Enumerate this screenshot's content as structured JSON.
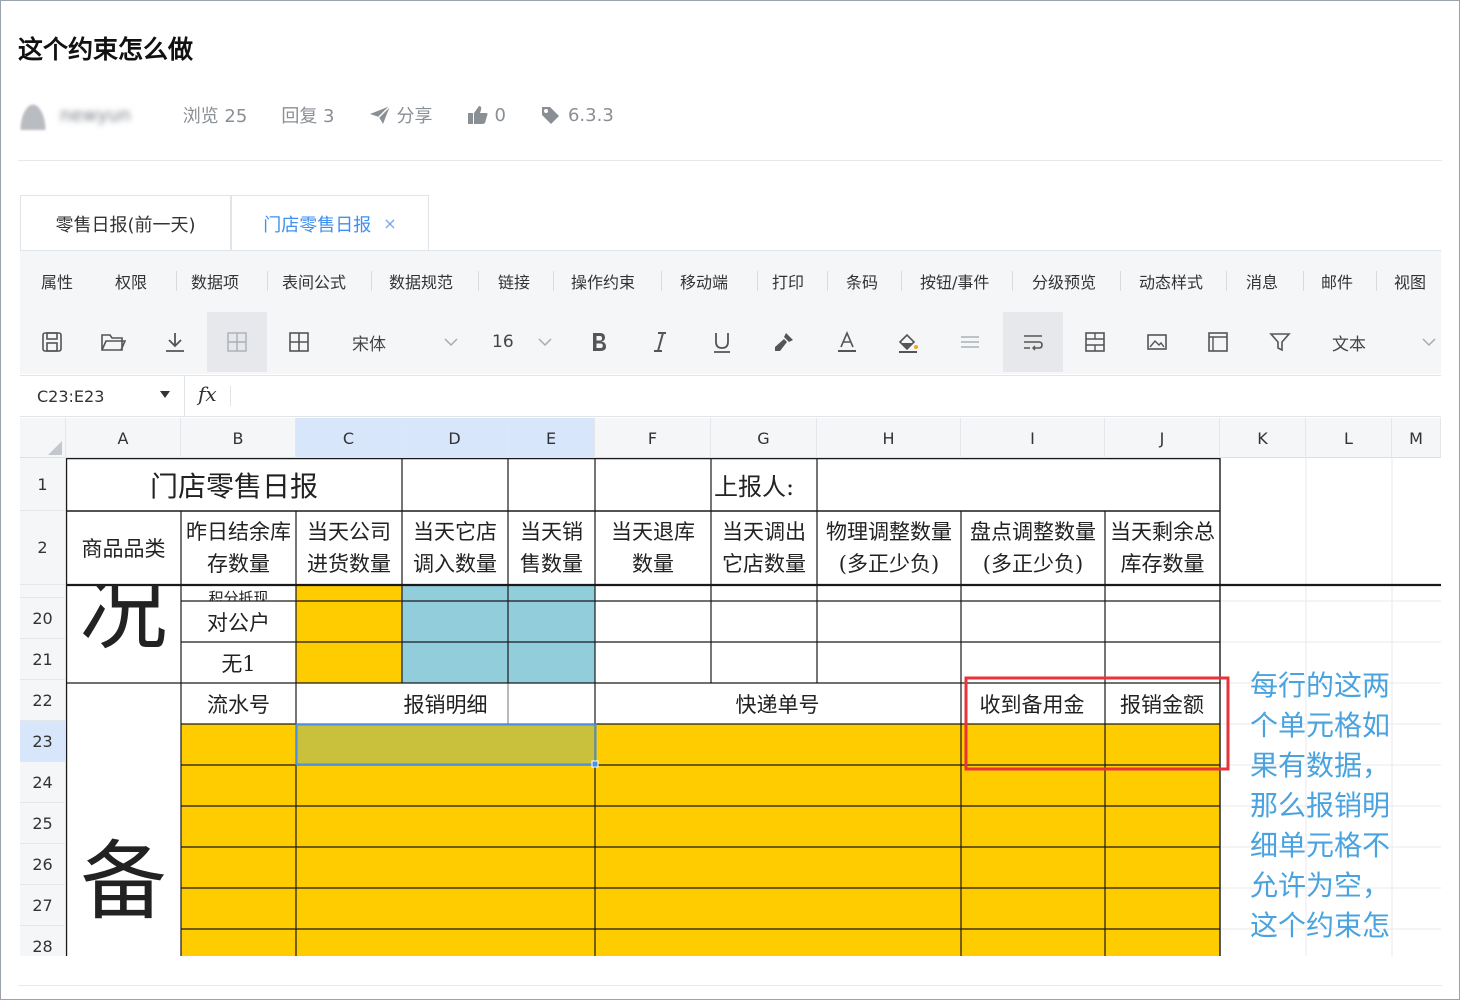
{
  "post": {
    "title": "这个约束怎么做",
    "user": "newyun",
    "views": "浏览 25",
    "replies": "回复 3",
    "share": "分享",
    "likes": "0",
    "version": "6.3.3"
  },
  "tabs": [
    "零售日报(前一天)",
    "门店零售日报"
  ],
  "tab_close": "×",
  "menu": [
    "属性",
    "权限",
    "数据项",
    "表间公式",
    "数据规范",
    "链接",
    "操作约束",
    "移动端",
    "打印",
    "条码",
    "按钮/事件",
    "分级预览",
    "动态样式",
    "消息",
    "邮件",
    "视图"
  ],
  "toolbar": {
    "font": "宋体",
    "size": "16",
    "format": "文本",
    "icons": [
      "save-icon",
      "open-folder-icon",
      "download-icon",
      "grid-border-icon",
      "table-icon",
      "bold-icon",
      "italic-icon",
      "underline-icon",
      "format-painter-icon",
      "font-color-icon",
      "fill-color-icon",
      "align-icon",
      "wrap-text-icon",
      "merge-icon",
      "image-icon",
      "frame-icon",
      "filter-icon"
    ]
  },
  "formula_bar": {
    "cell_ref": "C23:E23",
    "fx": "fx",
    "formula": ""
  },
  "columns": [
    "A",
    "B",
    "C",
    "D",
    "E",
    "F",
    "G",
    "H",
    "I",
    "J",
    "K",
    "L",
    "M"
  ],
  "rows": [
    "1",
    "2",
    "20",
    "21",
    "22",
    "23",
    "24",
    "25",
    "26",
    "27",
    "28"
  ],
  "sheet": {
    "title": "门店零售日报",
    "reporter": "上报人:",
    "headers": {
      "A": "商品品类",
      "B": [
        "昨日结余库",
        "存数量"
      ],
      "C": [
        "当天公司",
        "进货数量"
      ],
      "D": [
        "当天它店",
        "调入数量"
      ],
      "E": [
        "当天销",
        "售数量"
      ],
      "F": [
        "当天退库",
        "数量"
      ],
      "G": [
        "当天调出",
        "它店数量"
      ],
      "H": [
        "物理调整数量",
        "(多正少负)"
      ],
      "I": [
        "盘点调整数量",
        "(多正少负)"
      ],
      "J": [
        "当天剩余总",
        "库存数量"
      ]
    },
    "big_char_1": "况",
    "big_char_2": "备",
    "row19_partial": "积分抵现",
    "row20_b": "对公户",
    "row21_b": "无1",
    "row22": {
      "serial": "流水号",
      "detail": "报销明细",
      "express": "快递单号",
      "petty_cash": "收到备用金",
      "reimburse": "报销金额"
    }
  },
  "annotation": "每行的这两个单元格如果有数据，那么报销明细单元格不允许为空，这个约束怎",
  "colors": {
    "yellow": "#ffcc00",
    "blue_cell": "#92cddc",
    "olive_selected": "#c9c03c",
    "highlight_box": "#e8333a",
    "annotation": "#4aa3de",
    "tab_active": "#3d8ff0"
  }
}
